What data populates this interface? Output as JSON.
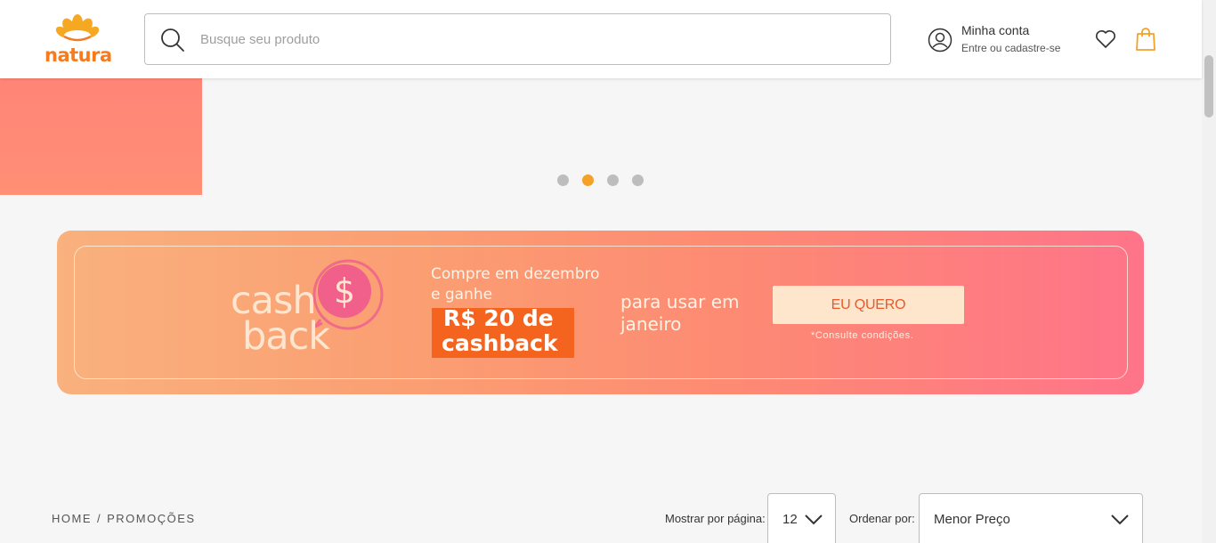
{
  "header": {
    "logo_text": "natura",
    "search": {
      "placeholder": "Busque seu produto"
    },
    "account": {
      "title": "Minha conta",
      "subtitle": "Entre ou cadastre-se"
    },
    "icons": {
      "search": "search-icon",
      "account": "user-circle-icon",
      "wishlist": "heart-icon",
      "cart": "shopping-bag-icon"
    }
  },
  "carousel": {
    "slide_count": 4,
    "active_index": 1
  },
  "banner": {
    "cash": "cash",
    "back": "back",
    "line1": "Compre em dezembro e ganhe",
    "amount": "R$ 20 de",
    "cashback": "cashback",
    "para_usar": "para usar em janeiro",
    "cta": "EU QUERO",
    "note": "*Consulte condições."
  },
  "breadcrumb": {
    "home": "HOME",
    "separator": "/",
    "current": "PROMOÇÕES"
  },
  "listing": {
    "per_page_label": "Mostrar por página:",
    "per_page_value": "12",
    "sort_label": "Ordenar por:",
    "sort_value": "Menor Preço"
  },
  "colors": {
    "brand_orange": "#f47b20",
    "dot_active": "#f4a12a",
    "cta_text": "#e9592a"
  }
}
